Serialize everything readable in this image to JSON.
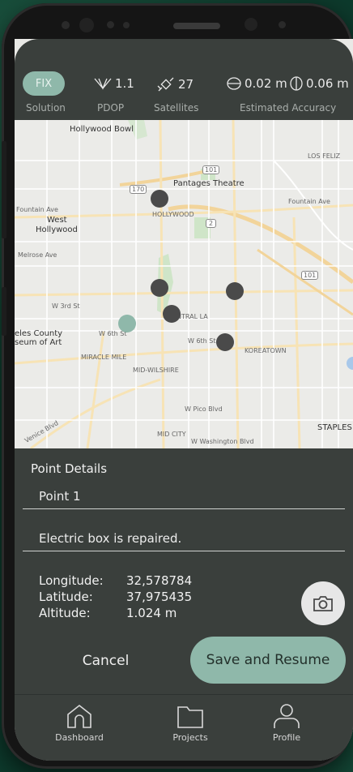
{
  "status": {
    "fix_label": "FIX",
    "pdop_value": "1.1",
    "satellites_value": "27",
    "horizontal_accuracy": "0.02 m",
    "vertical_accuracy": "0.06 m",
    "captions": {
      "solution": "Solution",
      "pdop": "PDOP",
      "satellites": "Satellites",
      "accuracy": "Estimated Accuracy"
    },
    "colors": {
      "accent": "#8fb8aa",
      "panel": "#3a3f3c"
    }
  },
  "map": {
    "labels": {
      "hollywood_bowl": "Hollywood Bowl",
      "pantages": "Pantages Theatre",
      "hollywood": "HOLLYWOOD",
      "west_hollywood": "West Hollywood",
      "los_feliz": "LOS FELIZ",
      "fountain_ave": "Fountain Ave",
      "melrose_ave": "Melrose Ave",
      "w_3rd_st": "W 3rd St",
      "w_6th_st": "W 6th St",
      "la_county_museum": "eles County\nseum of Art",
      "miracle_mile": "MIRACLE MILE",
      "mid_wilshire": "MID-WILSHIRE",
      "koreatown": "KOREATOWN",
      "central_la": "NTRAL LA",
      "mid_city": "MID CITY",
      "w_pico_blvd": "W Pico Blvd",
      "w_washington_blvd": "W Washington Blvd",
      "venice_blvd": "Venice Blvd",
      "staples": "STAPLES",
      "highway_101": "101",
      "highway_170": "170",
      "highway_2": "2"
    },
    "icons": [
      "map-pin-icon"
    ]
  },
  "sheet": {
    "title": "Point Details",
    "point_name": "Point 1",
    "note": "Electric box is repaired.",
    "coords": [
      {
        "label": "Longitude:",
        "value": "32,578784"
      },
      {
        "label": "Latitude:",
        "value": "37,975435"
      },
      {
        "label": "Altitude:",
        "value": "1.024 m"
      }
    ],
    "cancel_label": "Cancel",
    "save_label": "Save and Resume"
  },
  "tabs": [
    {
      "label": "Dashboard",
      "icon": "home-icon"
    },
    {
      "label": "Projects",
      "icon": "folder-icon"
    },
    {
      "label": "Profile",
      "icon": "user-icon"
    }
  ]
}
